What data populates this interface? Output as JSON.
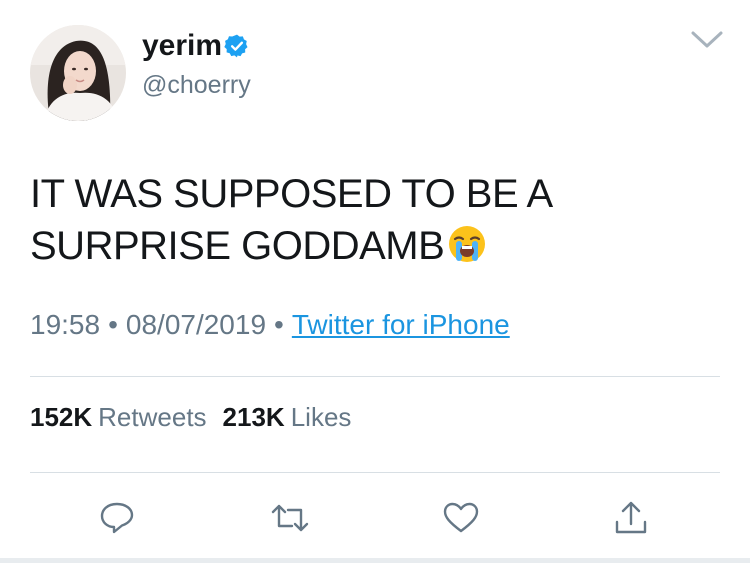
{
  "user": {
    "display_name": "yerim",
    "handle": "@choerry",
    "verified": true,
    "avatar_icon": "profile-photo"
  },
  "tweet": {
    "text_lines": [
      "IT WAS SUPPOSED TO BE A",
      "SURPRISE GODDAMB"
    ],
    "emoji": "loudly-crying-face",
    "time": "19:58",
    "date": "08/07/2019",
    "separator": "•",
    "source": "Twitter for iPhone"
  },
  "stats": {
    "retweets_count": "152K",
    "retweets_label": "Retweets",
    "likes_count": "213K",
    "likes_label": "Likes"
  },
  "actions": [
    "reply-icon",
    "retweet-icon",
    "like-icon",
    "share-icon"
  ],
  "colors": {
    "text_primary": "#14171a",
    "text_secondary": "#657786",
    "link": "#1b95e0",
    "verified_badge": "#1da1f2",
    "divider": "#d8dfe4"
  }
}
